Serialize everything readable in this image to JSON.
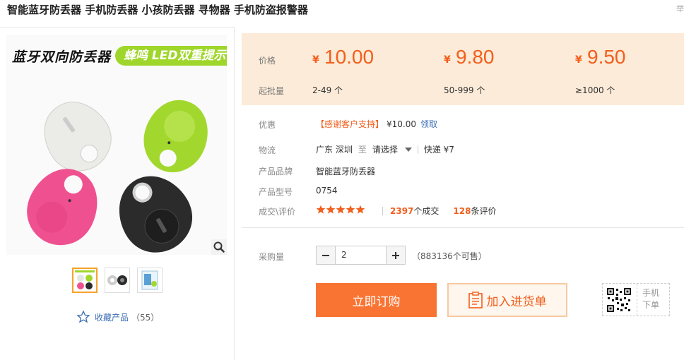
{
  "page": {
    "title": "智能蓝牙防丢器 手机防丢器 小孩防丢器 寻物器 手机防盗报警器",
    "corner_char": "举"
  },
  "gallery": {
    "banner_left": "蓝牙双向防丢器",
    "banner_right": "蜂鸣 LED双重提示",
    "zoom_icon": "search-icon",
    "thumbnail_count": 3,
    "active_thumbnail": 1
  },
  "favorite": {
    "label": "收藏产品",
    "count": "（55）"
  },
  "pricing": {
    "price_label": "价格",
    "batch_label": "起批量",
    "currency": "¥",
    "tiers": [
      {
        "price": "10.00",
        "range": "2-49 个"
      },
      {
        "price": "9.80",
        "range": "50-999 个"
      },
      {
        "price": "9.50",
        "range": "≥1000 个"
      }
    ]
  },
  "promotion": {
    "label": "优惠",
    "tag": "【感谢客户支持】",
    "amount": "¥10.00",
    "link": "领取"
  },
  "logistics": {
    "label": "物流",
    "origin": "广东 深圳",
    "to": "至",
    "destination": "请选择",
    "express": "快递 ¥7"
  },
  "brand": {
    "label": "产品品牌",
    "value": "智能蓝牙防丢器"
  },
  "model": {
    "label": "产品型号",
    "value": "0754"
  },
  "reviews": {
    "label": "成交\\评价",
    "rating": 5,
    "deals": "2397",
    "deals_suffix": "个成交",
    "review_count": "128",
    "review_suffix": "条评价"
  },
  "purchase": {
    "label": "采购量",
    "quantity": "2",
    "stock": "（883136个可售）",
    "buy_label": "立即订购",
    "cart_label": "加入进货单"
  },
  "mobile_order": {
    "line1": "手机",
    "line2": "下单"
  },
  "colors": {
    "accent": "#f25e1c",
    "buy_button": "#f97433",
    "price_bg": "#fcebd8",
    "link": "#3b6db3",
    "product_white": "#e9e9e6",
    "product_green": "#9fd62b",
    "product_pink": "#ee4d8a",
    "product_black": "#2a2a2a"
  }
}
